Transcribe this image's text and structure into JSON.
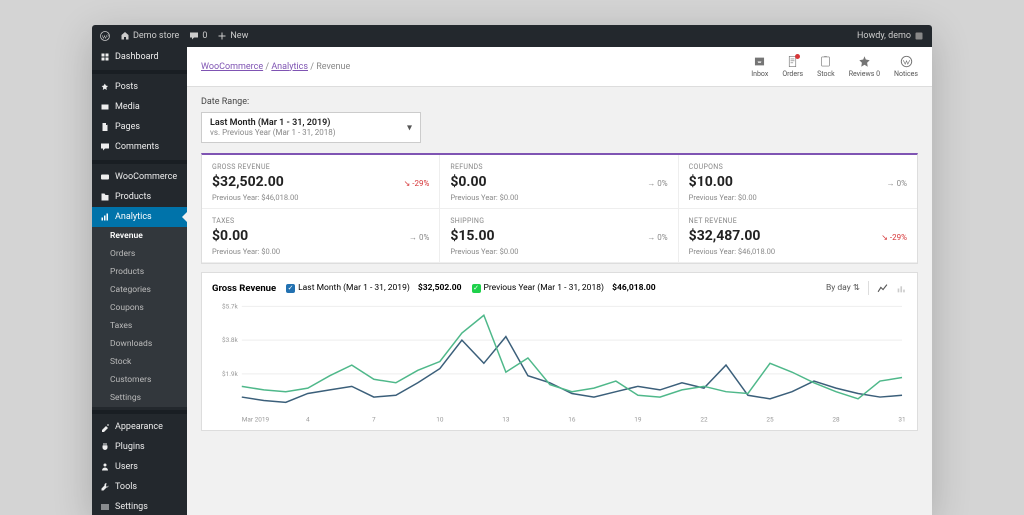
{
  "adminbar": {
    "site_name": "Demo store",
    "comments": "0",
    "new_label": "New",
    "howdy": "Howdy, demo"
  },
  "sidebar": {
    "items": [
      {
        "id": "dashboard",
        "label": "Dashboard",
        "icon": "dashboard"
      },
      {
        "id": "posts",
        "label": "Posts",
        "icon": "pin"
      },
      {
        "id": "media",
        "label": "Media",
        "icon": "media"
      },
      {
        "id": "pages",
        "label": "Pages",
        "icon": "page"
      },
      {
        "id": "comments",
        "label": "Comments",
        "icon": "comment"
      },
      {
        "id": "woocommerce",
        "label": "WooCommerce",
        "icon": "woo"
      },
      {
        "id": "products",
        "label": "Products",
        "icon": "products"
      },
      {
        "id": "analytics",
        "label": "Analytics",
        "icon": "analytics",
        "current": true
      },
      {
        "id": "appearance",
        "label": "Appearance",
        "icon": "appearance"
      },
      {
        "id": "plugins",
        "label": "Plugins",
        "icon": "plugin"
      },
      {
        "id": "users",
        "label": "Users",
        "icon": "users"
      },
      {
        "id": "tools",
        "label": "Tools",
        "icon": "tools"
      },
      {
        "id": "settings",
        "label": "Settings",
        "icon": "settings"
      }
    ],
    "submenu": [
      "Revenue",
      "Orders",
      "Products",
      "Categories",
      "Coupons",
      "Taxes",
      "Downloads",
      "Stock",
      "Customers",
      "Settings"
    ],
    "submenu_active": "Revenue"
  },
  "breadcrumb": {
    "a": "WooCommerce",
    "b": "Analytics",
    "c": "Revenue"
  },
  "topbar_icons": [
    "Inbox",
    "Orders",
    "Stock",
    "Reviews 0",
    "Notices"
  ],
  "daterange": {
    "title": "Date Range:",
    "primary": "Last Month (Mar 1 - 31, 2019)",
    "secondary": "vs. Previous Year (Mar 1 - 31, 2018)"
  },
  "stats": [
    {
      "label": "GROSS REVENUE",
      "value": "$32,502.00",
      "delta": "-29%",
      "dir": "down",
      "prev": "Previous Year: $46,018.00"
    },
    {
      "label": "REFUNDS",
      "value": "$0.00",
      "delta": "0%",
      "dir": "flat",
      "prev": "Previous Year: $0.00"
    },
    {
      "label": "COUPONS",
      "value": "$10.00",
      "delta": "0%",
      "dir": "flat",
      "prev": "Previous Year: $0.00"
    },
    {
      "label": "TAXES",
      "value": "$0.00",
      "delta": "0%",
      "dir": "flat",
      "prev": "Previous Year: $0.00"
    },
    {
      "label": "SHIPPING",
      "value": "$15.00",
      "delta": "0%",
      "dir": "flat",
      "prev": "Previous Year: $0.00"
    },
    {
      "label": "NET REVENUE",
      "value": "$32,487.00",
      "delta": "-29%",
      "dir": "down",
      "prev": "Previous Year: $46,018.00"
    }
  ],
  "chart": {
    "title": "Gross Revenue",
    "legend1_label": "Last Month (Mar 1 - 31, 2019)",
    "legend1_value": "$32,502.00",
    "legend2_label": "Previous Year (Mar 1 - 31, 2018)",
    "legend2_value": "$46,018.00",
    "interval": "By day"
  },
  "chart_data": {
    "type": "line",
    "xlabel": "Mar 2019",
    "x": [
      1,
      2,
      3,
      4,
      5,
      6,
      7,
      8,
      9,
      10,
      11,
      12,
      13,
      14,
      15,
      16,
      17,
      18,
      19,
      20,
      21,
      22,
      23,
      24,
      25,
      26,
      27,
      28,
      29,
      30,
      31
    ],
    "x_ticks": [
      "Mar 2019",
      "4",
      "7",
      "10",
      "13",
      "16",
      "19",
      "22",
      "25",
      "28",
      "31"
    ],
    "y_ticks": [
      "$1.9k",
      "$3.8k",
      "$5.7k"
    ],
    "ylim": [
      0,
      5700
    ],
    "series": [
      {
        "name": "Last Month (Mar 1 - 31, 2019)",
        "color": "#3b5f7a",
        "values": [
          600,
          400,
          300,
          800,
          1000,
          1200,
          600,
          700,
          1400,
          2200,
          3800,
          2500,
          4000,
          1800,
          1400,
          800,
          600,
          900,
          1200,
          1000,
          1400,
          1100,
          2400,
          700,
          500,
          900,
          1500,
          1100,
          800,
          600,
          700
        ]
      },
      {
        "name": "Previous Year (Mar 1 - 31, 2018)",
        "color": "#4fb88a",
        "values": [
          1200,
          1000,
          900,
          1100,
          1800,
          2400,
          1600,
          1400,
          2100,
          2600,
          4200,
          5200,
          2000,
          2800,
          1300,
          900,
          1100,
          1500,
          700,
          600,
          1000,
          1200,
          900,
          800,
          2500,
          2000,
          1400,
          900,
          500,
          1500,
          1700
        ]
      }
    ]
  }
}
